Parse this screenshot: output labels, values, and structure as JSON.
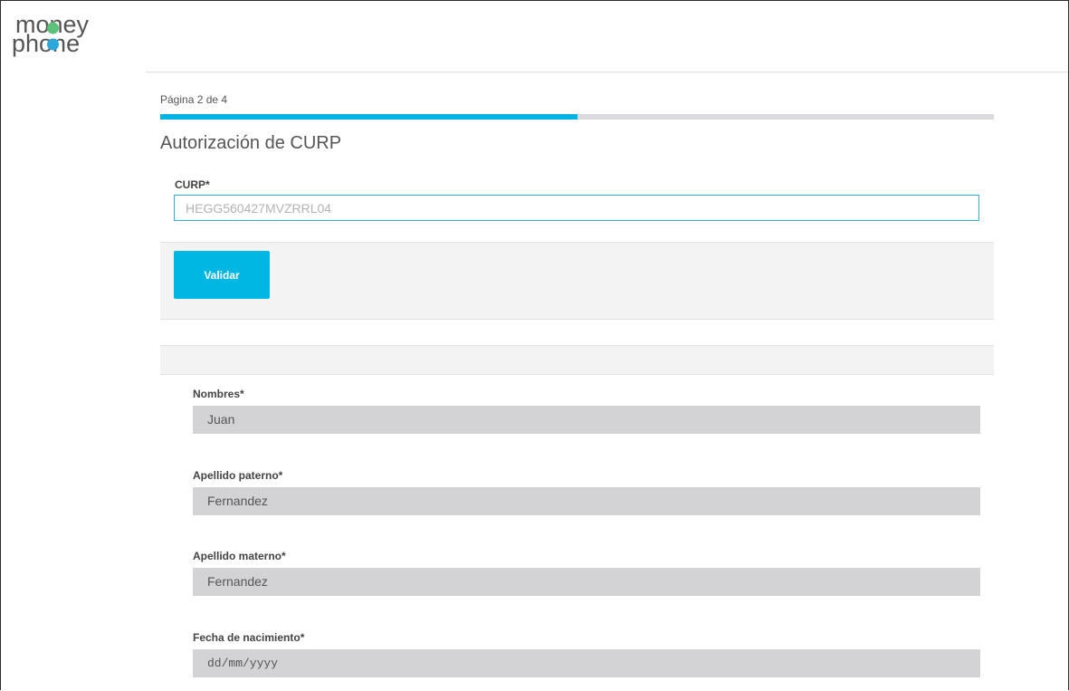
{
  "brand": {
    "logo_line1": "money",
    "logo_line2": "phone",
    "colors": {
      "accent": "#00b7e3",
      "progress_track": "#d9d9de",
      "field_bg": "#d3d3d6",
      "logo_dot_blue": "#2aa8dc",
      "logo_dot_green": "#5cc27a"
    }
  },
  "form": {
    "page_indicator": "Página 2 de 4",
    "progress": {
      "current": 2,
      "total": 4,
      "fraction": 0.5
    },
    "section_title": "Autorización de CURP",
    "curp": {
      "label": "CURP*",
      "placeholder": "HEGG560427MVZRRL04",
      "value": ""
    },
    "validate_label": "Validar",
    "fields": [
      {
        "label": "Nombres*",
        "value": "Juan"
      },
      {
        "label": "Apellido paterno*",
        "value": "Fernandez"
      },
      {
        "label": "Apellido materno*",
        "value": "Fernandez"
      },
      {
        "label": "Fecha de nacimiento*",
        "value": "dd/mm/yyyy"
      }
    ]
  }
}
